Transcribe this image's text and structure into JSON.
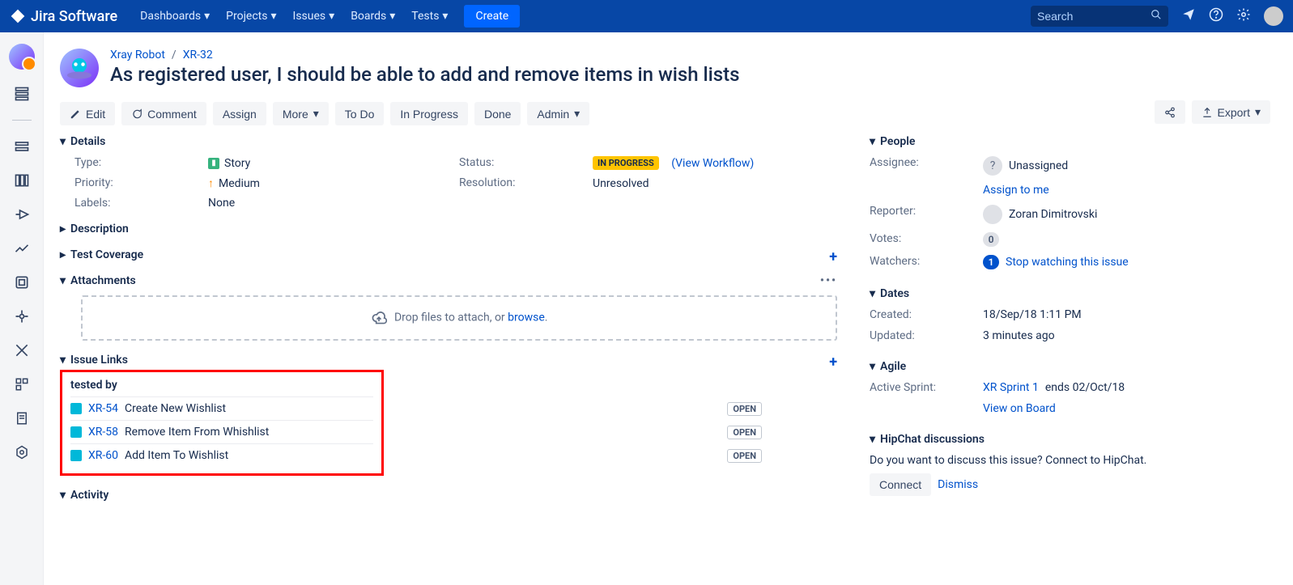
{
  "topbar": {
    "product": "Jira Software",
    "nav": [
      "Dashboards",
      "Projects",
      "Issues",
      "Boards",
      "Tests"
    ],
    "create": "Create",
    "search_placeholder": "Search"
  },
  "breadcrumb": {
    "project": "Xray Robot",
    "key": "XR-32"
  },
  "title": "As registered user, I should be able to add and remove items in wish lists",
  "toolbar": {
    "edit": "Edit",
    "comment": "Comment",
    "assign": "Assign",
    "more": "More",
    "todo": "To Do",
    "inprogress": "In Progress",
    "done": "Done",
    "admin": "Admin",
    "export": "Export"
  },
  "sections": {
    "details": "Details",
    "description": "Description",
    "coverage": "Test Coverage",
    "attachments": "Attachments",
    "links": "Issue Links",
    "activity": "Activity",
    "people": "People",
    "dates": "Dates",
    "agile": "Agile",
    "hipchat": "HipChat discussions"
  },
  "details": {
    "type_label": "Type:",
    "type_value": "Story",
    "priority_label": "Priority:",
    "priority_value": "Medium",
    "labels_label": "Labels:",
    "labels_value": "None",
    "status_label": "Status:",
    "status_value": "IN PROGRESS",
    "view_workflow": "(View Workflow)",
    "resolution_label": "Resolution:",
    "resolution_value": "Unresolved"
  },
  "attachments": {
    "prompt_a": "Drop files to attach, or ",
    "prompt_b": "browse",
    "prompt_c": "."
  },
  "links": {
    "group": "tested by",
    "items": [
      {
        "key": "XR-54",
        "summary": "Create New Wishlist",
        "status": "OPEN"
      },
      {
        "key": "XR-58",
        "summary": "Remove Item From Whishlist",
        "status": "OPEN"
      },
      {
        "key": "XR-60",
        "summary": "Add Item To Wishlist",
        "status": "OPEN"
      }
    ]
  },
  "people": {
    "assignee_label": "Assignee:",
    "assignee_value": "Unassigned",
    "assign_to_me": "Assign to me",
    "reporter_label": "Reporter:",
    "reporter_value": "Zoran Dimitrovski",
    "votes_label": "Votes:",
    "votes_value": "0",
    "watchers_label": "Watchers:",
    "watchers_value": "1",
    "stop_watching": "Stop watching this issue"
  },
  "dates": {
    "created_label": "Created:",
    "created_value": "18/Sep/18 1:11 PM",
    "updated_label": "Updated:",
    "updated_value": "3 minutes ago"
  },
  "agile": {
    "sprint_label": "Active Sprint:",
    "sprint_link": "XR Sprint 1",
    "sprint_suffix": " ends 02/Oct/18",
    "view_board": "View on Board"
  },
  "hipchat": {
    "prompt": "Do you want to discuss this issue? Connect to HipChat.",
    "connect": "Connect",
    "dismiss": "Dismiss"
  }
}
